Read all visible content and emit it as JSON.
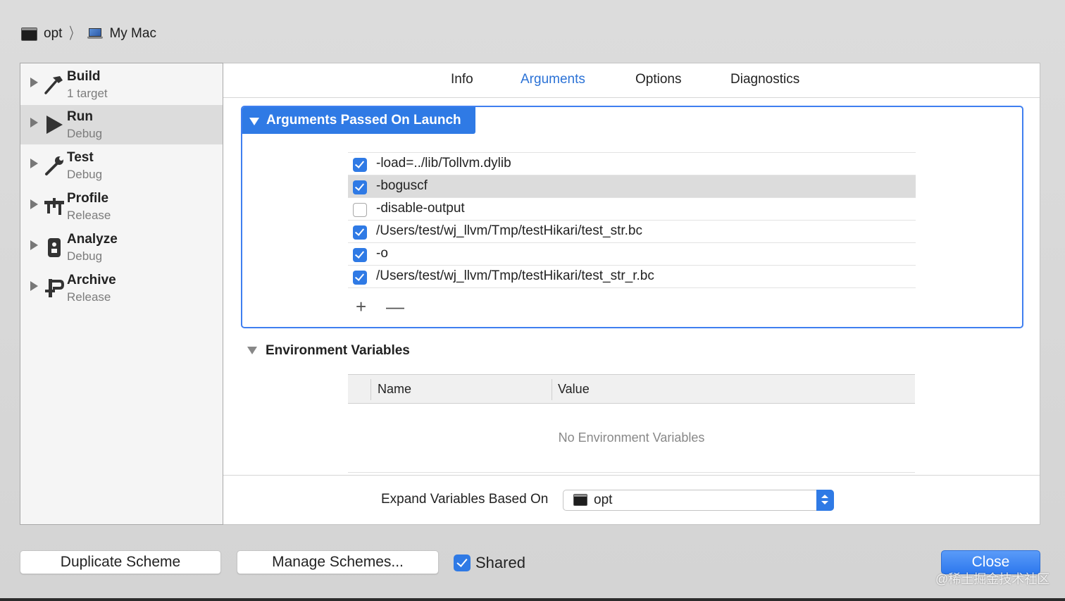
{
  "breadcrumb": {
    "project": "opt",
    "destination": "My Mac"
  },
  "sidebar": {
    "items": [
      {
        "name": "Build",
        "sub": "1 target"
      },
      {
        "name": "Run",
        "sub": "Debug"
      },
      {
        "name": "Test",
        "sub": "Debug"
      },
      {
        "name": "Profile",
        "sub": "Release"
      },
      {
        "name": "Analyze",
        "sub": "Debug"
      },
      {
        "name": "Archive",
        "sub": "Release"
      }
    ],
    "selected": "Run"
  },
  "tabs": {
    "items": [
      "Info",
      "Arguments",
      "Options",
      "Diagnostics"
    ],
    "active": "Arguments"
  },
  "arguments": {
    "title": "Arguments Passed On Launch",
    "rows": [
      {
        "text": "-load=../lib/Tollvm.dylib",
        "checked": true
      },
      {
        "text": "-boguscf",
        "checked": true
      },
      {
        "text": "-disable-output",
        "checked": false
      },
      {
        "text": "/Users/test/wj_llvm/Tmp/testHikari/test_str.bc",
        "checked": true
      },
      {
        "text": "-o",
        "checked": true
      },
      {
        "text": "/Users/test/wj_llvm/Tmp/testHikari/test_str_r.bc",
        "checked": true
      }
    ],
    "add_label": "+",
    "remove_label": "—"
  },
  "env": {
    "title": "Environment Variables",
    "col_name": "Name",
    "col_value": "Value",
    "empty": "No Environment Variables"
  },
  "expand": {
    "label": "Expand Variables Based On",
    "value": "opt"
  },
  "buttons": {
    "duplicate": "Duplicate Scheme",
    "manage": "Manage Schemes...",
    "shared": "Shared",
    "close": "Close"
  },
  "watermark": "@稀土掘金技术社区",
  "colors": {
    "accent": "#2f7ae5"
  }
}
